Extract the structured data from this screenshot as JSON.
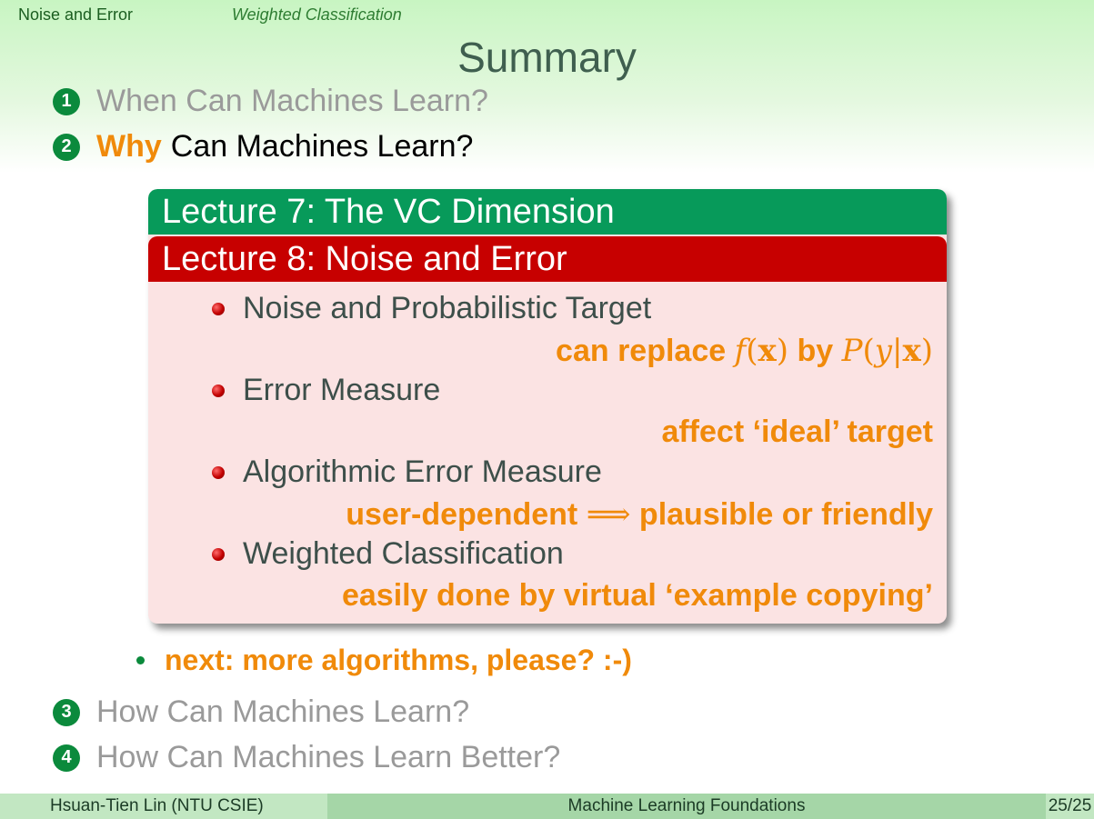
{
  "header": {
    "section": "Noise and Error",
    "subsection": "Weighted Classification"
  },
  "title": "Summary",
  "toc": [
    {
      "num": "1",
      "text": "When Can Machines Learn?"
    },
    {
      "num": "2",
      "highlight": "Why",
      "text": "Can Machines Learn?"
    },
    {
      "num": "3",
      "text": "How Can Machines Learn?"
    },
    {
      "num": "4",
      "text": "How Can Machines Learn Better?"
    }
  ],
  "box": {
    "lecture7": "Lecture 7: The VC Dimension",
    "lecture8": "Lecture 8: Noise and Error",
    "items": [
      {
        "title": "Noise and Probabilistic Target",
        "note_prefix": "can replace",
        "note_f": "f",
        "note_x1": "x",
        "note_by": "by",
        "note_P": "P",
        "note_y": "y",
        "note_x2": "x"
      },
      {
        "title": "Error Measure",
        "note": "affect ‘ideal’ target"
      },
      {
        "title": "Algorithmic Error Measure",
        "note_left": "user-dependent",
        "note_arrow": "⟹",
        "note_right": "plausible or friendly"
      },
      {
        "title": "Weighted Classification",
        "note": "easily done by virtual ‘example copying’"
      }
    ]
  },
  "next": "next: more algorithms, please? :-)",
  "footer": {
    "author": "Hsuan-Tien Lin  (NTU CSIE)",
    "course": "Machine Learning Foundations",
    "page": "25/25"
  },
  "colors": {
    "accent_orange": "#f08a0a",
    "green_header": "#079a5a",
    "red_header": "#c70000"
  }
}
